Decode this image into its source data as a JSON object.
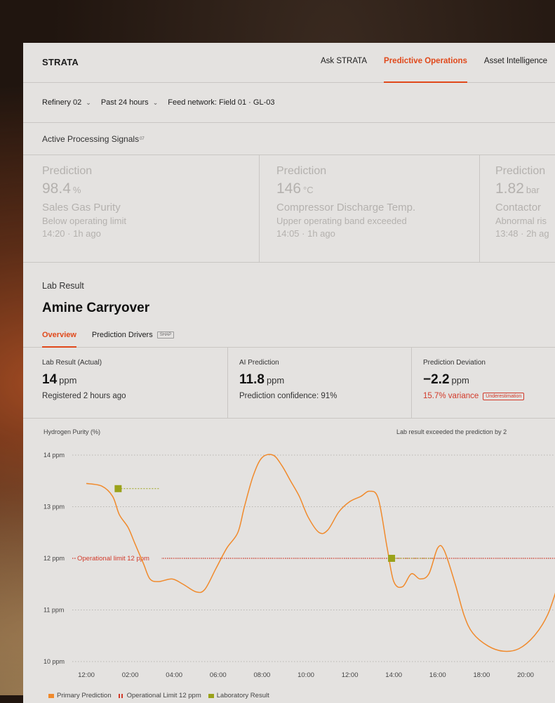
{
  "app": {
    "brand": "STRATA"
  },
  "nav": {
    "items": [
      {
        "label": "Ask STRATA",
        "active": false
      },
      {
        "label": "Predictive Operations",
        "active": true
      },
      {
        "label": "Asset Intelligence",
        "active": false
      }
    ]
  },
  "filters": {
    "site": "Refinery 02",
    "range": "Past 24 hours",
    "feed": "Feed network: Field 01 · GL-03"
  },
  "signals": {
    "title": "Active Processing Signals",
    "count": "07",
    "items": [
      {
        "label": "Prediction",
        "value": "98.4",
        "unit": "%",
        "name": "Sales Gas Purity",
        "status": "Below operating limit",
        "time": "14:20 · 1h ago"
      },
      {
        "label": "Prediction",
        "value": "146",
        "unit": "°C",
        "name": "Compressor Discharge Temp.",
        "status": "Upper operating band exceeded",
        "time": "14:05 · 1h ago"
      },
      {
        "label": "Prediction",
        "value": "1.82",
        "unit": "bar",
        "name": "Contactor",
        "status": "Abnormal ris",
        "time": "13:48 · 2h ag"
      }
    ]
  },
  "lab": {
    "label": "Lab Result",
    "title": "Amine Carryover",
    "tabs": [
      {
        "label": "Overview",
        "active": true
      },
      {
        "label": "Prediction Drivers",
        "badge": "SHAP",
        "active": false
      }
    ],
    "metrics": [
      {
        "header": "Lab Result (Actual)",
        "value": "14",
        "unit": "ppm",
        "sub": "Registered 2 hours ago"
      },
      {
        "header": "AI Prediction",
        "value": "11.8",
        "unit": "ppm",
        "sub": "Prediction confidence: 91%"
      },
      {
        "header": "Prediction Deviation",
        "value": "−2.2",
        "unit": "ppm",
        "sub": "15.7% variance",
        "tag": "Underestimation"
      }
    ]
  },
  "colors": {
    "accent": "#e0481a",
    "prediction": "#f08a2c",
    "limit": "#d23a2a",
    "lab": "#9aa21a"
  },
  "chart_data": {
    "type": "line",
    "ylabel": "Hydrogen Purity (%)",
    "note": "Lab result exceeded the prediction by 2",
    "ylim": [
      10,
      14
    ],
    "y_ticks": [
      "14 ppm",
      "13 ppm",
      "12 ppm",
      "11 ppm",
      "10 ppm"
    ],
    "x_ticks": [
      "12:00",
      "02:00",
      "04:00",
      "06:00",
      "08:00",
      "10:00",
      "12:00",
      "14:00",
      "16:00",
      "18:00",
      "20:00"
    ],
    "limit": {
      "value": 12,
      "label": "Operational limit 12 ppm"
    },
    "series": [
      {
        "name": "Primary Prediction",
        "points": [
          [
            0.0,
            13.45
          ],
          [
            0.7,
            13.4
          ],
          [
            1.2,
            13.2
          ],
          [
            1.5,
            12.85
          ],
          [
            1.9,
            12.6
          ],
          [
            2.2,
            12.3
          ],
          [
            2.6,
            11.9
          ],
          [
            2.9,
            11.6
          ],
          [
            3.3,
            11.55
          ],
          [
            3.9,
            11.6
          ],
          [
            4.4,
            11.5
          ],
          [
            5.0,
            11.35
          ],
          [
            5.4,
            11.4
          ],
          [
            5.9,
            11.8
          ],
          [
            6.4,
            12.2
          ],
          [
            6.9,
            12.5
          ],
          [
            7.2,
            13.0
          ],
          [
            7.6,
            13.6
          ],
          [
            8.0,
            13.95
          ],
          [
            8.5,
            14.0
          ],
          [
            8.9,
            13.8
          ],
          [
            9.3,
            13.5
          ],
          [
            9.7,
            13.2
          ],
          [
            10.1,
            12.8
          ],
          [
            10.6,
            12.5
          ],
          [
            11.0,
            12.55
          ],
          [
            11.5,
            12.9
          ],
          [
            12.0,
            13.1
          ],
          [
            12.5,
            13.2
          ],
          [
            12.9,
            13.3
          ],
          [
            13.3,
            13.15
          ],
          [
            13.7,
            12.2
          ],
          [
            14.0,
            11.55
          ],
          [
            14.4,
            11.45
          ],
          [
            14.8,
            11.7
          ],
          [
            15.2,
            11.6
          ],
          [
            15.6,
            11.7
          ],
          [
            16.0,
            12.2
          ],
          [
            16.3,
            12.15
          ],
          [
            16.8,
            11.5
          ],
          [
            17.2,
            10.9
          ],
          [
            17.6,
            10.55
          ],
          [
            18.3,
            10.3
          ],
          [
            19.0,
            10.2
          ],
          [
            19.7,
            10.25
          ],
          [
            20.4,
            10.5
          ],
          [
            21.0,
            10.9
          ],
          [
            21.5,
            11.5
          ],
          [
            21.9,
            11.9
          ],
          [
            22.1,
            12.0
          ]
        ]
      },
      {
        "name": "Operational Limit 12 ppm"
      },
      {
        "name": "Laboratory Result",
        "points": [
          [
            1.45,
            13.35
          ],
          [
            13.9,
            12.0
          ]
        ]
      }
    ],
    "legend": "bottom-left"
  }
}
